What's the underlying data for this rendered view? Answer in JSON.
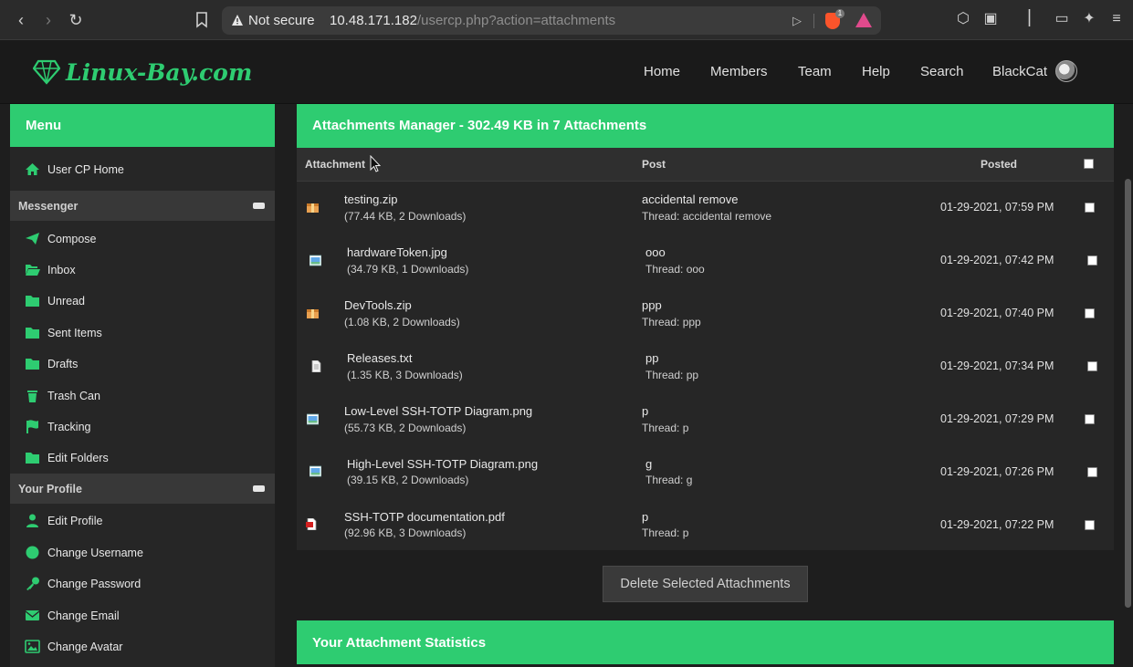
{
  "browser": {
    "not_secure": "Not secure",
    "url_host": "10.48.171.182",
    "url_path": "/usercp.php?action=attachments",
    "brave_badge": "1"
  },
  "site": {
    "logo_text": "Linux-Bay.com",
    "nav": [
      "Home",
      "Members",
      "Team",
      "Help",
      "Search",
      "BlackCat"
    ]
  },
  "sidebar": {
    "menu_title": "Menu",
    "user_cp_home": "User CP Home",
    "messenger": {
      "title": "Messenger",
      "items": [
        "Compose",
        "Inbox",
        "Unread",
        "Sent Items",
        "Drafts",
        "Trash Can",
        "Tracking",
        "Edit Folders"
      ]
    },
    "profile": {
      "title": "Your Profile",
      "items": [
        "Edit Profile",
        "Change Username",
        "Change Password",
        "Change Email",
        "Change Avatar"
      ]
    }
  },
  "main": {
    "title": "Attachments Manager - 302.49 KB in 7 Attachments",
    "columns": {
      "attachment": "Attachment",
      "post": "Post",
      "posted": "Posted"
    },
    "rows": [
      {
        "icon": "zip-icon",
        "name": "testing.zip",
        "meta": "(77.44 KB, 2 Downloads)",
        "post": "accidental remove",
        "thread": "Thread: accidental remove",
        "date": "01-29-2021, 07:59 PM"
      },
      {
        "icon": "image-icon",
        "name": "hardwareToken.jpg",
        "meta": "(34.79 KB, 1 Downloads)",
        "post": "ooo",
        "thread": "Thread: ooo",
        "date": "01-29-2021, 07:42 PM"
      },
      {
        "icon": "zip-icon",
        "name": "DevTools.zip",
        "meta": "(1.08 KB, 2 Downloads)",
        "post": "ppp",
        "thread": "Thread: ppp",
        "date": "01-29-2021, 07:40 PM"
      },
      {
        "icon": "text-file-icon",
        "name": "Releases.txt",
        "meta": "(1.35 KB, 3 Downloads)",
        "post": "pp",
        "thread": "Thread: pp",
        "date": "01-29-2021, 07:34 PM"
      },
      {
        "icon": "image-icon",
        "name": "Low-Level SSH-TOTP Diagram.png",
        "meta": "(55.73 KB, 2 Downloads)",
        "post": "p",
        "thread": "Thread: p",
        "date": "01-29-2021, 07:29 PM"
      },
      {
        "icon": "image-icon",
        "name": "High-Level SSH-TOTP Diagram.png",
        "meta": "(39.15 KB, 2 Downloads)",
        "post": "g",
        "thread": "Thread: g",
        "date": "01-29-2021, 07:26 PM"
      },
      {
        "icon": "pdf-icon",
        "name": "SSH-TOTP documentation.pdf",
        "meta": "(92.96 KB, 3 Downloads)",
        "post": "p",
        "thread": "Thread: p",
        "date": "01-29-2021, 07:22 PM"
      }
    ],
    "delete_button": "Delete Selected Attachments",
    "stats_title": "Your Attachment Statistics"
  },
  "colors": {
    "accent": "#2ecc71",
    "background": "#1e1e1e",
    "panel": "#262626"
  }
}
